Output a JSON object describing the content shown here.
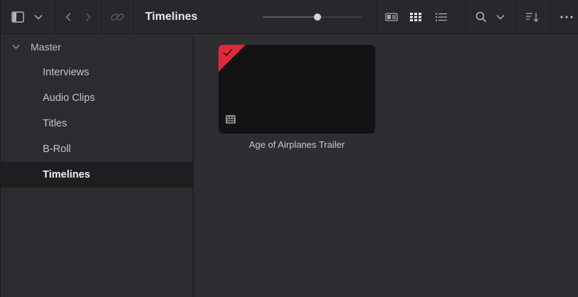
{
  "toolbar": {
    "title": "Timelines",
    "zoom_level": 0.55,
    "icons": [
      "sidebar-toggle-icon",
      "chevron-down-icon",
      "back-icon",
      "forward-icon",
      "link-icon",
      "metadata-view-icon",
      "thumbnail-view-icon",
      "list-view-icon",
      "search-icon",
      "chevron-down-icon",
      "sort-icon",
      "more-icon"
    ]
  },
  "sidebar": {
    "root_label": "Master",
    "bins": [
      {
        "label": "Interviews",
        "selected": false
      },
      {
        "label": "Audio Clips",
        "selected": false
      },
      {
        "label": "Titles",
        "selected": false
      },
      {
        "label": "B-Roll",
        "selected": false
      },
      {
        "label": "Timelines",
        "selected": true
      }
    ]
  },
  "content": {
    "clips": [
      {
        "name": "Age of Airplanes Trailer",
        "flag_color": "#e0293b",
        "type": "timeline"
      }
    ]
  }
}
